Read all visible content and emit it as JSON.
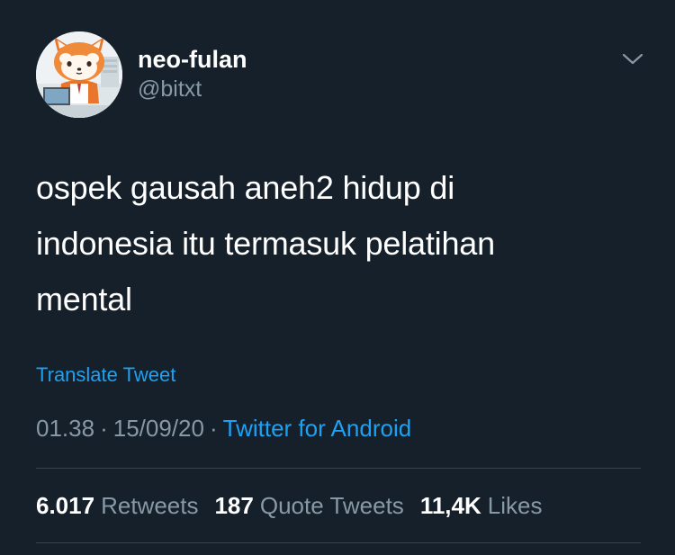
{
  "tweet": {
    "author": {
      "display_name": "neo-fulan",
      "handle": "@bitxt"
    },
    "text_lines": [
      "ospek gausah aneh2 hidup di",
      "indonesia itu termasuk pelatihan",
      "mental"
    ],
    "translate_label": "Translate Tweet",
    "time": "01.38",
    "date": "15/09/20",
    "source": "Twitter for Android",
    "separator": "·",
    "stats": {
      "retweets_count": "6.017",
      "retweets_label": "Retweets",
      "quote_count": "187",
      "quote_label": "Quote Tweets",
      "likes_count": "11,4K",
      "likes_label": "Likes"
    }
  },
  "icons": {
    "menu": "chevron-down-icon",
    "avatar": "red-panda-cartoon-avatar"
  },
  "colors": {
    "background": "#15202b",
    "text_primary": "#ffffff",
    "text_secondary": "#8899a6",
    "accent": "#1da1f2",
    "divider": "#38444d"
  }
}
